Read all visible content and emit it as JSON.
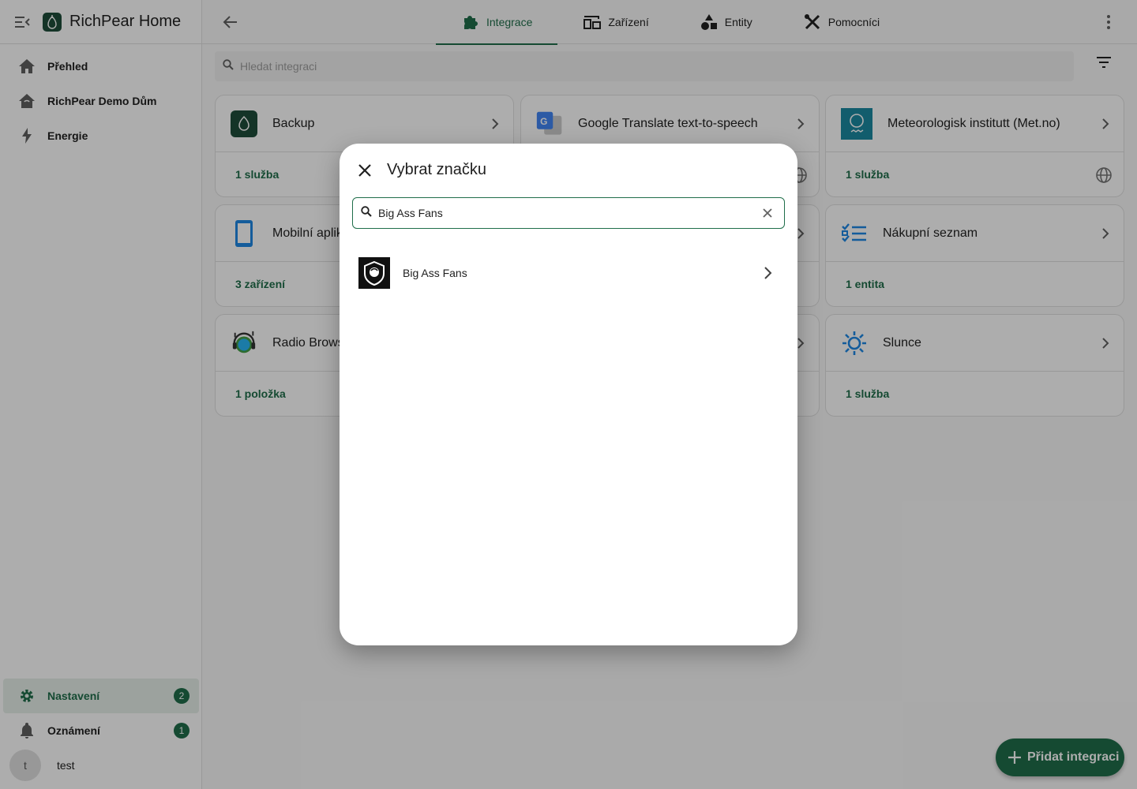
{
  "app": {
    "title": "RichPear Home"
  },
  "sidebar": {
    "items": [
      {
        "label": "Přehled",
        "icon": "home-icon"
      },
      {
        "label": "RichPear Demo Dům",
        "icon": "home-outline-icon"
      },
      {
        "label": "Energie",
        "icon": "lightning-icon"
      }
    ],
    "bottom": [
      {
        "label": "Nastavení",
        "icon": "gear-icon",
        "badge": "2"
      },
      {
        "label": "Oznámení",
        "icon": "bell-icon",
        "badge": "1"
      }
    ],
    "user": {
      "initial": "t",
      "name": "test"
    }
  },
  "tabs": [
    {
      "label": "Integrace",
      "icon": "puzzle-icon",
      "active": true
    },
    {
      "label": "Zařízení",
      "icon": "devices-icon"
    },
    {
      "label": "Entity",
      "icon": "shapes-icon"
    },
    {
      "label": "Pomocníci",
      "icon": "tools-icon"
    }
  ],
  "search": {
    "placeholder": "Hledat integraci"
  },
  "cards": [
    {
      "name": "Backup",
      "detail": "1 služba"
    },
    {
      "name": "Google Translate text-to-speech",
      "detail": ""
    },
    {
      "name": "Meteorologisk institutt (Met.no)",
      "detail": "1 služba"
    },
    {
      "name": "Mobilní aplik",
      "detail": "3 zařízení"
    },
    {
      "name": "Nákupní seznam",
      "detail": "1 entita"
    },
    {
      "name": "Radio Brows",
      "detail": "1 položka"
    },
    {
      "name": "Slunce",
      "detail": "1 služba"
    }
  ],
  "fab": {
    "label": "Přidat integraci"
  },
  "dialog": {
    "title": "Vybrat značku",
    "search_value": "Big Ass Fans",
    "results": [
      {
        "name": "Big Ass Fans"
      }
    ]
  },
  "colors": {
    "accent": "#1f6e4a",
    "scrim": "rgba(0,0,0,0.32)"
  }
}
